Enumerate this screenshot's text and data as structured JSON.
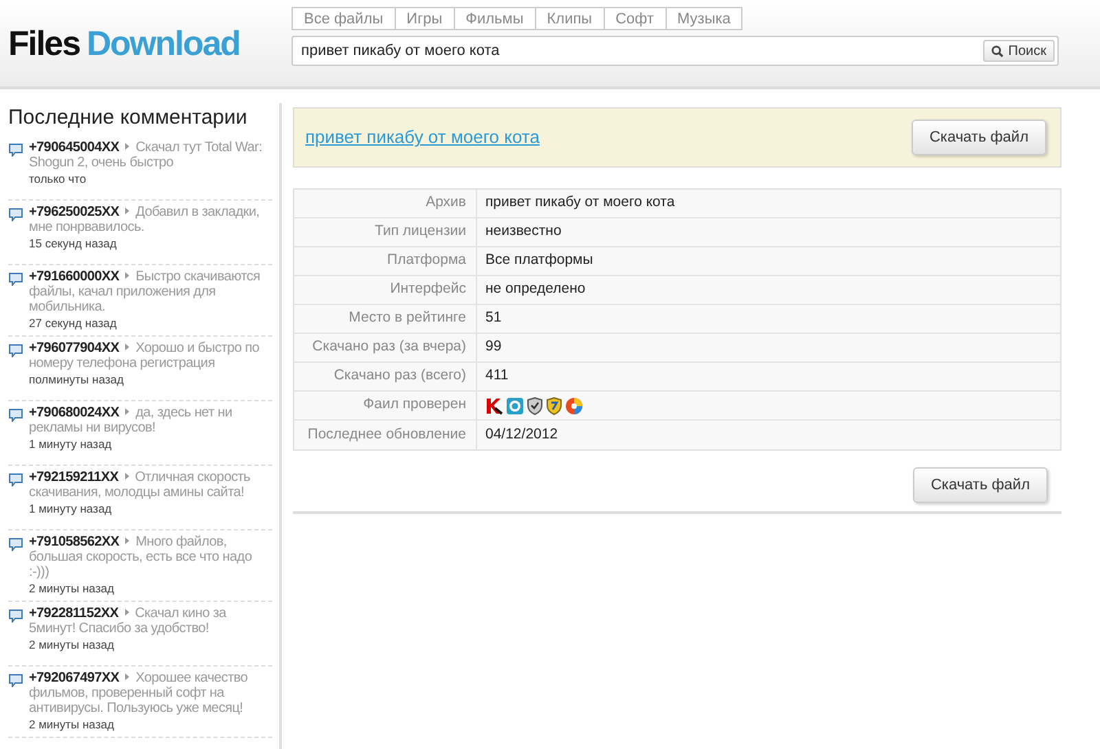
{
  "logo": {
    "part_1": "Files",
    "part_2": "Download"
  },
  "tabs": [
    "Все файлы",
    "Игры",
    "Фильмы",
    "Клипы",
    "Софт",
    "Музыка"
  ],
  "search": {
    "value": "привет пикабу от моего кота",
    "button": "Поиск"
  },
  "sidebar": {
    "title": "Последние комментарии",
    "comments": [
      {
        "author": "+790645004XX",
        "text": "Скачал тут Total War: Shogun 2, очень быстро",
        "time": "только что"
      },
      {
        "author": "+796250025XX",
        "text": "Добавил в закладки, мне понрвавилось.",
        "time": "15 секунд назад"
      },
      {
        "author": "+791660000XX",
        "text": "Быстро скачиваются файлы, качал приложения для мобильника.",
        "time": "27 секунд назад"
      },
      {
        "author": "+796077904XX",
        "text": "Хорошо и быстро по номеру телефона регистрация",
        "time": "полминуты назад"
      },
      {
        "author": "+790680024XX",
        "text": "да, здесь нет ни рекламы ни вирусов!",
        "time": "1 минуту назад"
      },
      {
        "author": "+792159211XX",
        "text": "Отличная скорость скачивания, молодцы амины сайта!",
        "time": "1 минуту назад"
      },
      {
        "author": "+791058562XX",
        "text": "Много файлов, большая скорость, есть все что надо :-)))",
        "time": "2 минуты назад"
      },
      {
        "author": "+792281152XX",
        "text": "Скачал кино за 5минут! Спасибо за удобство!",
        "time": "2 минуты назад"
      },
      {
        "author": "+792067497XX",
        "text": "Хорошее качество фильмов, проверенный софт на антивирусы. Пользуюсь уже месяц!",
        "time": "2 минуты назад"
      }
    ]
  },
  "file": {
    "title": "привет пикабу от моего кота",
    "download_button": "Скачать файл"
  },
  "details": [
    {
      "label": "Архив",
      "kind": "text",
      "value": "привет пикабу от моего кота"
    },
    {
      "label": "Тип лицензии",
      "kind": "text",
      "value": "неизвестно"
    },
    {
      "label": "Платформа",
      "kind": "text",
      "value": "Все платформы"
    },
    {
      "label": "Интерфейс",
      "kind": "text",
      "value": "не определено"
    },
    {
      "label": "Место в рейтинге",
      "kind": "text",
      "value": "51"
    },
    {
      "label": "Скачано раз (за вчера)",
      "kind": "text",
      "value": "99"
    },
    {
      "label": "Скачано раз (всего)",
      "kind": "text",
      "value": "411"
    },
    {
      "label": "Фаил проверен",
      "kind": "icons"
    },
    {
      "label": "Последнее обновление",
      "kind": "text",
      "value": "04/12/2012"
    }
  ],
  "bottom_button": "Скачать файл"
}
